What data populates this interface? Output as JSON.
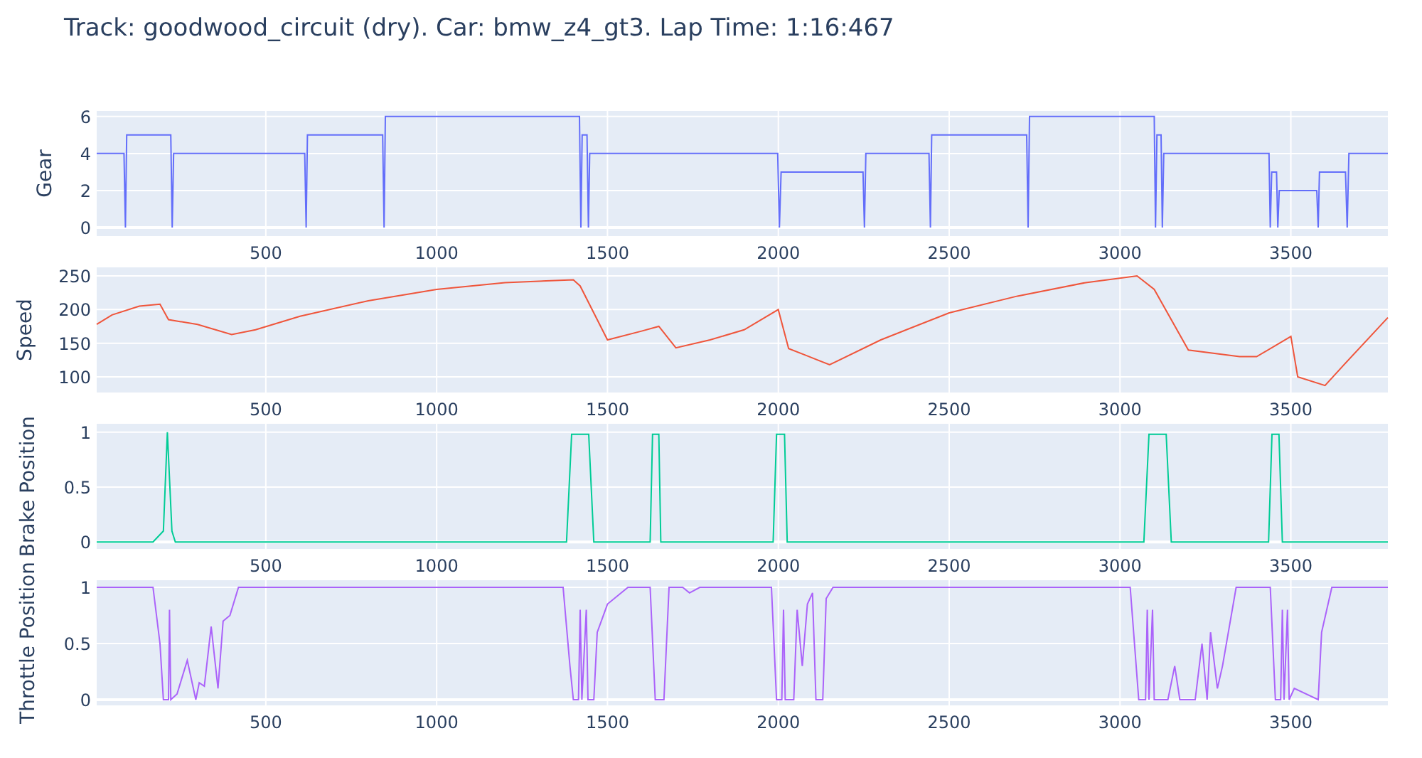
{
  "title": "Track: goodwood_circuit (dry). Car: bmw_z4_gt3. Lap Time: 1:16:467",
  "charts": [
    {
      "chart_data": {
        "type": "line",
        "grid": true,
        "ylabel": "Gear",
        "xlim": [
          5,
          3784
        ],
        "ylim": [
          -0.46,
          6.3
        ],
        "xticks": [
          500,
          1000,
          1500,
          2000,
          2500,
          3000,
          3500
        ],
        "yticks": [
          0,
          2,
          4,
          6
        ],
        "x": [
          5,
          85,
          89,
          93,
          222,
          226,
          230,
          614,
          618,
          622,
          842,
          846,
          850,
          1418,
          1422,
          1426,
          1440,
          1444,
          1448,
          1998,
          2003,
          2008,
          2248,
          2252,
          2256,
          2441,
          2445,
          2449,
          2727,
          2731,
          2735,
          3100,
          3104,
          3108,
          3120,
          3124,
          3128,
          3436,
          3440,
          3444,
          3458,
          3462,
          3466,
          3576,
          3580,
          3584,
          3660,
          3665,
          3670,
          3784
        ],
        "series": [
          {
            "color": "#636efa",
            "values": [
              4,
              4,
              0,
              5,
              5,
              0,
              4,
              4,
              0,
              5,
              5,
              0,
              6,
              6,
              0,
              5,
              5,
              0,
              4,
              4,
              0,
              3,
              3,
              0,
              4,
              4,
              0,
              5,
              5,
              0,
              6,
              6,
              0,
              5,
              5,
              0,
              4,
              4,
              0,
              3,
              3,
              0,
              2,
              2,
              0,
              3,
              3,
              0,
              4,
              4
            ]
          }
        ]
      }
    },
    {
      "chart_data": {
        "type": "line",
        "grid": true,
        "ylabel": "Speed",
        "xlim": [
          5,
          3784
        ],
        "ylim": [
          76.7,
          262.7
        ],
        "xticks": [
          500,
          1000,
          1500,
          2000,
          2500,
          3000,
          3500
        ],
        "yticks": [
          100,
          150,
          200,
          250
        ],
        "x": [
          5,
          50,
          130,
          190,
          215,
          300,
          400,
          470,
          600,
          800,
          1000,
          1200,
          1400,
          1420,
          1500,
          1600,
          1650,
          1700,
          1800,
          1900,
          2000,
          2030,
          2080,
          2150,
          2300,
          2500,
          2700,
          2900,
          3050,
          3100,
          3200,
          3350,
          3400,
          3500,
          3520,
          3600,
          3650,
          3784
        ],
        "series": [
          {
            "color": "#ef553b",
            "values": [
              178,
              192,
              205,
              208,
              185,
              178,
              163,
              170,
              190,
              213,
              230,
              240,
              244,
              235,
              155,
              168,
              175,
              143,
              155,
              170,
              200,
              142,
              132,
              118,
              155,
              195,
              220,
              240,
              250,
              230,
              140,
              130,
              130,
              160,
              100,
              87,
              115,
              188
            ]
          }
        ]
      }
    },
    {
      "chart_data": {
        "type": "line",
        "grid": true,
        "ylabel": "Brake Position",
        "xlim": [
          5,
          3784
        ],
        "ylim": [
          -0.063,
          1.076
        ],
        "xticks": [
          500,
          1000,
          1500,
          2000,
          2500,
          3000,
          3500
        ],
        "yticks": [
          0,
          0.5,
          1
        ],
        "x": [
          5,
          170,
          200,
          212,
          225,
          235,
          1380,
          1395,
          1445,
          1460,
          1625,
          1632,
          1650,
          1656,
          1985,
          1995,
          2018,
          2026,
          3070,
          3085,
          3135,
          3150,
          3435,
          3445,
          3465,
          3475,
          3784
        ],
        "series": [
          {
            "color": "#00cc96",
            "values": [
              0,
              0,
              0.1,
              1,
              0.1,
              0,
              0,
              0.98,
              0.98,
              0,
              0,
              0.98,
              0.98,
              0,
              0,
              0.98,
              0.98,
              0,
              0,
              0.98,
              0.98,
              0,
              0,
              0.98,
              0.98,
              0,
              0
            ]
          }
        ]
      }
    },
    {
      "chart_data": {
        "type": "line",
        "grid": true,
        "ylabel": "Throttle Position",
        "xlim": [
          5,
          3784
        ],
        "ylim": [
          -0.051,
          1.063
        ],
        "xticks": [
          500,
          1000,
          1500,
          2000,
          2500,
          3000,
          3500
        ],
        "yticks": [
          0,
          0.5,
          1
        ],
        "x": [
          5,
          170,
          190,
          200,
          215,
          218,
          222,
          240,
          270,
          295,
          305,
          320,
          340,
          360,
          375,
          395,
          420,
          1370,
          1390,
          1400,
          1415,
          1420,
          1425,
          1438,
          1443,
          1460,
          1470,
          1500,
          1560,
          1625,
          1640,
          1665,
          1680,
          1720,
          1740,
          1770,
          1980,
          1995,
          2010,
          2015,
          2020,
          2045,
          2055,
          2070,
          2085,
          2100,
          2110,
          2130,
          2140,
          2160,
          3030,
          3055,
          3075,
          3080,
          3085,
          3095,
          3100,
          3140,
          3160,
          3175,
          3220,
          3240,
          3255,
          3265,
          3285,
          3300,
          3340,
          3440,
          3455,
          3470,
          3475,
          3480,
          3490,
          3495,
          3510,
          3580,
          3590,
          3620,
          3784
        ],
        "series": [
          {
            "color": "#ab63fa",
            "values": [
              1,
              1,
              0.5,
              0,
              0,
              0.8,
              0,
              0.05,
              0.35,
              0,
              0.15,
              0.12,
              0.65,
              0.1,
              0.7,
              0.75,
              1,
              1,
              0.3,
              0,
              0,
              0.8,
              0,
              0.8,
              0,
              0,
              0.6,
              0.85,
              1,
              1,
              0,
              0,
              1,
              1,
              0.95,
              1,
              1,
              0,
              0,
              0.8,
              0,
              0,
              0.8,
              0.3,
              0.85,
              0.95,
              0,
              0,
              0.9,
              1,
              1,
              0,
              0,
              0.8,
              0,
              0.8,
              0,
              0,
              0.3,
              0,
              0,
              0.5,
              0,
              0.6,
              0.1,
              0.3,
              1,
              1,
              0,
              0,
              0.8,
              0,
              0.8,
              0,
              0.1,
              0,
              0.6,
              1,
              1
            ]
          }
        ]
      }
    }
  ]
}
